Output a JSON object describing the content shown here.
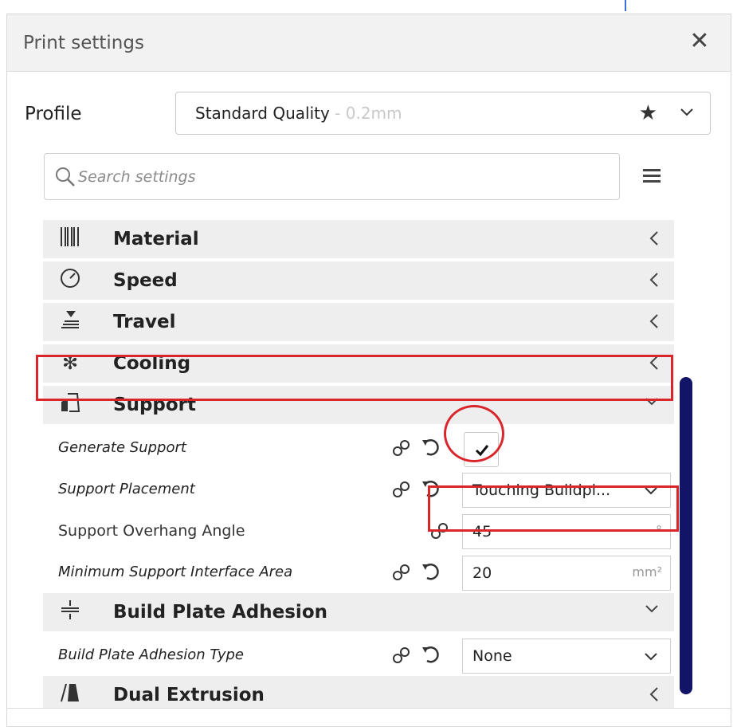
{
  "panel": {
    "title": "Print settings",
    "close_icon": "close-icon"
  },
  "profile": {
    "label": "Profile",
    "name": "Standard Quality",
    "layer": " - 0.2mm"
  },
  "search": {
    "placeholder": "Search settings"
  },
  "categories": {
    "material": "Material",
    "speed": "Speed",
    "travel": "Travel",
    "cooling": "Cooling",
    "support": "Support",
    "adhesion": "Build Plate Adhesion",
    "dual": "Dual Extrusion"
  },
  "settings": {
    "generate_support": {
      "label": "Generate Support",
      "checked": true
    },
    "support_placement": {
      "label": "Support Placement",
      "value": "Touching Buildpl..."
    },
    "overhang_angle": {
      "label": "Support Overhang Angle",
      "value": "45",
      "unit": "°"
    },
    "min_interface_area": {
      "label": "Minimum Support Interface Area",
      "value": "20",
      "unit": "mm²"
    },
    "adhesion_type": {
      "label": "Build Plate Adhesion Type",
      "value": "None"
    }
  },
  "colors": {
    "highlight": "#d9262b",
    "scrollbar": "#121467"
  }
}
